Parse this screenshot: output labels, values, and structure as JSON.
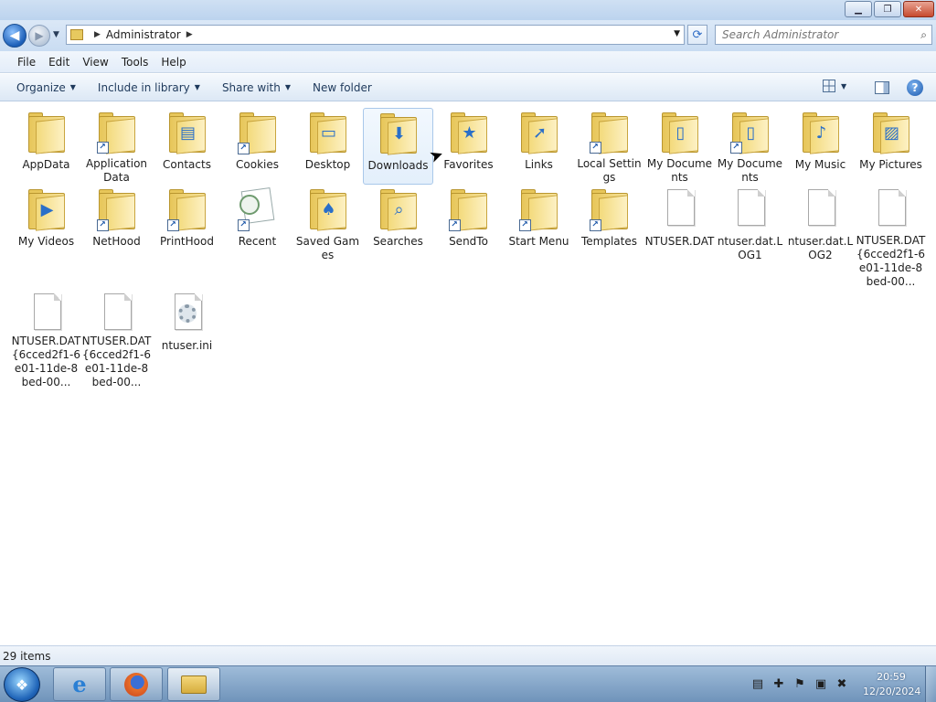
{
  "window": {
    "controls": {
      "minimize": "▁",
      "maximize": "❐",
      "close": "✕"
    }
  },
  "address": {
    "breadcrumb": [
      "Administrator"
    ],
    "search_placeholder": "Search Administrator"
  },
  "menu": [
    "File",
    "Edit",
    "View",
    "Tools",
    "Help"
  ],
  "commands": {
    "organize": "Organize",
    "include_in_library": "Include in library",
    "share_with": "Share with",
    "new_folder": "New folder"
  },
  "items": [
    {
      "label": "AppData",
      "kind": "folder",
      "icon": "appdata-folder-icon"
    },
    {
      "label": "Application Data",
      "kind": "folder",
      "icon": "application-data-folder-icon",
      "shortcut": true
    },
    {
      "label": "Contacts",
      "kind": "folder",
      "icon": "contacts-folder-icon",
      "overlay": "▤"
    },
    {
      "label": "Cookies",
      "kind": "folder",
      "icon": "cookies-folder-icon",
      "shortcut": true
    },
    {
      "label": "Desktop",
      "kind": "folder",
      "icon": "desktop-folder-icon",
      "overlay": "▭"
    },
    {
      "label": "Downloads",
      "kind": "folder",
      "icon": "downloads-folder-icon",
      "overlay": "⬇",
      "selected": true
    },
    {
      "label": "Favorites",
      "kind": "folder",
      "icon": "favorites-folder-icon",
      "overlay": "★"
    },
    {
      "label": "Links",
      "kind": "folder",
      "icon": "links-folder-icon",
      "overlay": "➚"
    },
    {
      "label": "Local Settings",
      "kind": "folder",
      "icon": "local-settings-folder-icon",
      "shortcut": true
    },
    {
      "label": "My Documents",
      "kind": "folder",
      "icon": "my-documents-folder-icon",
      "overlay": "▯"
    },
    {
      "label": "My Documents",
      "kind": "folder",
      "icon": "my-documents-shortcut-folder-icon",
      "overlay": "▯",
      "shortcut": true
    },
    {
      "label": "My Music",
      "kind": "folder",
      "icon": "my-music-folder-icon",
      "overlay": "♪"
    },
    {
      "label": "My Pictures",
      "kind": "folder",
      "icon": "my-pictures-folder-icon",
      "overlay": "▨"
    },
    {
      "label": "My Videos",
      "kind": "folder",
      "icon": "my-videos-folder-icon",
      "overlay": "▶"
    },
    {
      "label": "NetHood",
      "kind": "folder",
      "icon": "nethood-folder-icon",
      "shortcut": true
    },
    {
      "label": "PrintHood",
      "kind": "folder",
      "icon": "printhood-folder-icon",
      "shortcut": true
    },
    {
      "label": "Recent",
      "kind": "recent",
      "icon": "recent-items-icon",
      "shortcut": true
    },
    {
      "label": "Saved Games",
      "kind": "folder",
      "icon": "saved-games-folder-icon",
      "overlay": "♠"
    },
    {
      "label": "Searches",
      "kind": "folder",
      "icon": "searches-folder-icon",
      "overlay": "⌕"
    },
    {
      "label": "SendTo",
      "kind": "folder",
      "icon": "sendto-folder-icon",
      "shortcut": true
    },
    {
      "label": "Start Menu",
      "kind": "folder",
      "icon": "start-menu-folder-icon",
      "shortcut": true
    },
    {
      "label": "Templates",
      "kind": "folder",
      "icon": "templates-folder-icon",
      "shortcut": true
    },
    {
      "label": "NTUSER.DAT",
      "kind": "file",
      "icon": "file-icon"
    },
    {
      "label": "ntuser.dat.LOG1",
      "kind": "file",
      "icon": "file-icon"
    },
    {
      "label": "ntuser.dat.LOG2",
      "kind": "file",
      "icon": "file-icon"
    },
    {
      "label": "NTUSER.DAT{6cced2f1-6e01-11de-8bed-00...",
      "kind": "file",
      "icon": "file-icon"
    },
    {
      "label": "NTUSER.DAT{6cced2f1-6e01-11de-8bed-00...",
      "kind": "file",
      "icon": "file-icon"
    },
    {
      "label": "NTUSER.DAT{6cced2f1-6e01-11de-8bed-00...",
      "kind": "file",
      "icon": "file-icon"
    },
    {
      "label": "ntuser.ini",
      "kind": "settings",
      "icon": "settings-file-icon"
    }
  ],
  "status": {
    "item_count": "29 items"
  },
  "taskbar": {
    "clock_time": "20:59",
    "clock_date": "12/20/2024",
    "tray_icons": [
      "action-center-icon",
      "security-icon",
      "flag-icon",
      "network-icon",
      "volume-muted-icon"
    ]
  }
}
